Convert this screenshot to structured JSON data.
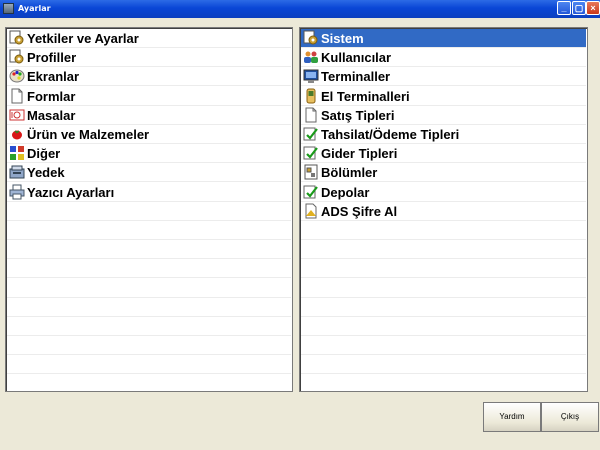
{
  "window": {
    "title": "Ayarlar"
  },
  "left_list": {
    "items": [
      {
        "label": "Yetkiler ve Ayarlar",
        "icon": "settings-icon"
      },
      {
        "label": "Profiller",
        "icon": "settings-icon"
      },
      {
        "label": "Ekranlar",
        "icon": "palette-icon"
      },
      {
        "label": "Formlar",
        "icon": "document-icon"
      },
      {
        "label": "Masalar",
        "icon": "table-icon"
      },
      {
        "label": "Ürün ve Malzemeler",
        "icon": "tomato-icon"
      },
      {
        "label": "Diğer",
        "icon": "misc-icon"
      },
      {
        "label": "Yedek",
        "icon": "backup-icon"
      },
      {
        "label": "Yazıcı Ayarları",
        "icon": "printer-icon"
      }
    ]
  },
  "right_list": {
    "selected_index": 0,
    "items": [
      {
        "label": "Sistem",
        "icon": "settings-icon"
      },
      {
        "label": "Kullanıcılar",
        "icon": "users-icon"
      },
      {
        "label": "Terminaller",
        "icon": "monitor-icon"
      },
      {
        "label": "El Terminalleri",
        "icon": "handheld-icon"
      },
      {
        "label": "Satış Tipleri",
        "icon": "document-icon"
      },
      {
        "label": "Tahsilat/Ödeme Tipleri",
        "icon": "checklist-icon"
      },
      {
        "label": "Gider Tipleri",
        "icon": "checklist-icon"
      },
      {
        "label": "Bölümler",
        "icon": "section-icon"
      },
      {
        "label": "Depolar",
        "icon": "checklist-icon"
      },
      {
        "label": "ADS Şifre Al",
        "icon": "key-icon"
      }
    ]
  },
  "buttons": {
    "help": "Yardım",
    "exit": "Çıkış"
  },
  "colors": {
    "selection": "#316ac5",
    "titlebar": "#0a46d6",
    "window_bg": "#ece9d8"
  }
}
